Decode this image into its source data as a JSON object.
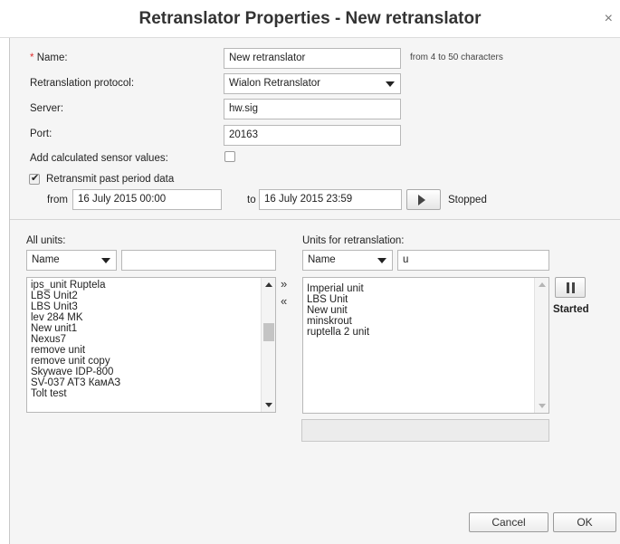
{
  "window": {
    "title": "Retranslator Properties - New retranslator",
    "close_glyph": "×"
  },
  "form": {
    "name": {
      "required_mark": "*",
      "label": "Name:",
      "value": "New retranslator",
      "hint": "from 4 to 50 characters"
    },
    "protocol": {
      "label": "Retranslation protocol:",
      "value": "Wialon Retranslator"
    },
    "server": {
      "label": "Server:",
      "value": "hw.sig"
    },
    "port": {
      "label": "Port:",
      "value": "20163"
    },
    "calc_sensors": {
      "label": "Add calculated sensor values:",
      "checked": false
    },
    "past_period": {
      "label": "Retransmit past period data",
      "checked": true
    },
    "from": {
      "label": "from",
      "value": "16 July 2015 00:00"
    },
    "to": {
      "label": "to",
      "value": "16 July 2015 23:59"
    },
    "status": "Stopped"
  },
  "all_units": {
    "label": "All units:",
    "filter_field": "Name",
    "filter_text": "",
    "items": [
      "ips_unit Ruptela",
      "LBS Unit2",
      "LBS Unit3",
      "lev 284 MK",
      "New unit1",
      "Nexus7",
      "remove unit",
      "remove unit copy",
      "Skywave IDP-800",
      "SV-037 AT3 КамАЗ",
      "Tolt test"
    ]
  },
  "transfer": {
    "add_glyph": "»",
    "remove_glyph": "«"
  },
  "retranslation_units": {
    "label": "Units for retranslation:",
    "filter_field": "Name",
    "filter_text": "u",
    "items": [
      "Imperial unit",
      "LBS Unit",
      "New unit",
      "minskrout",
      "ruptella 2 unit"
    ],
    "state": "Started"
  },
  "buttons": {
    "cancel": "Cancel",
    "ok": "OK"
  },
  "icons": {
    "close": "close-icon",
    "dropdown": "chevron-down-icon",
    "play": "play-icon",
    "pause": "pause-icon",
    "check": "check-icon"
  }
}
